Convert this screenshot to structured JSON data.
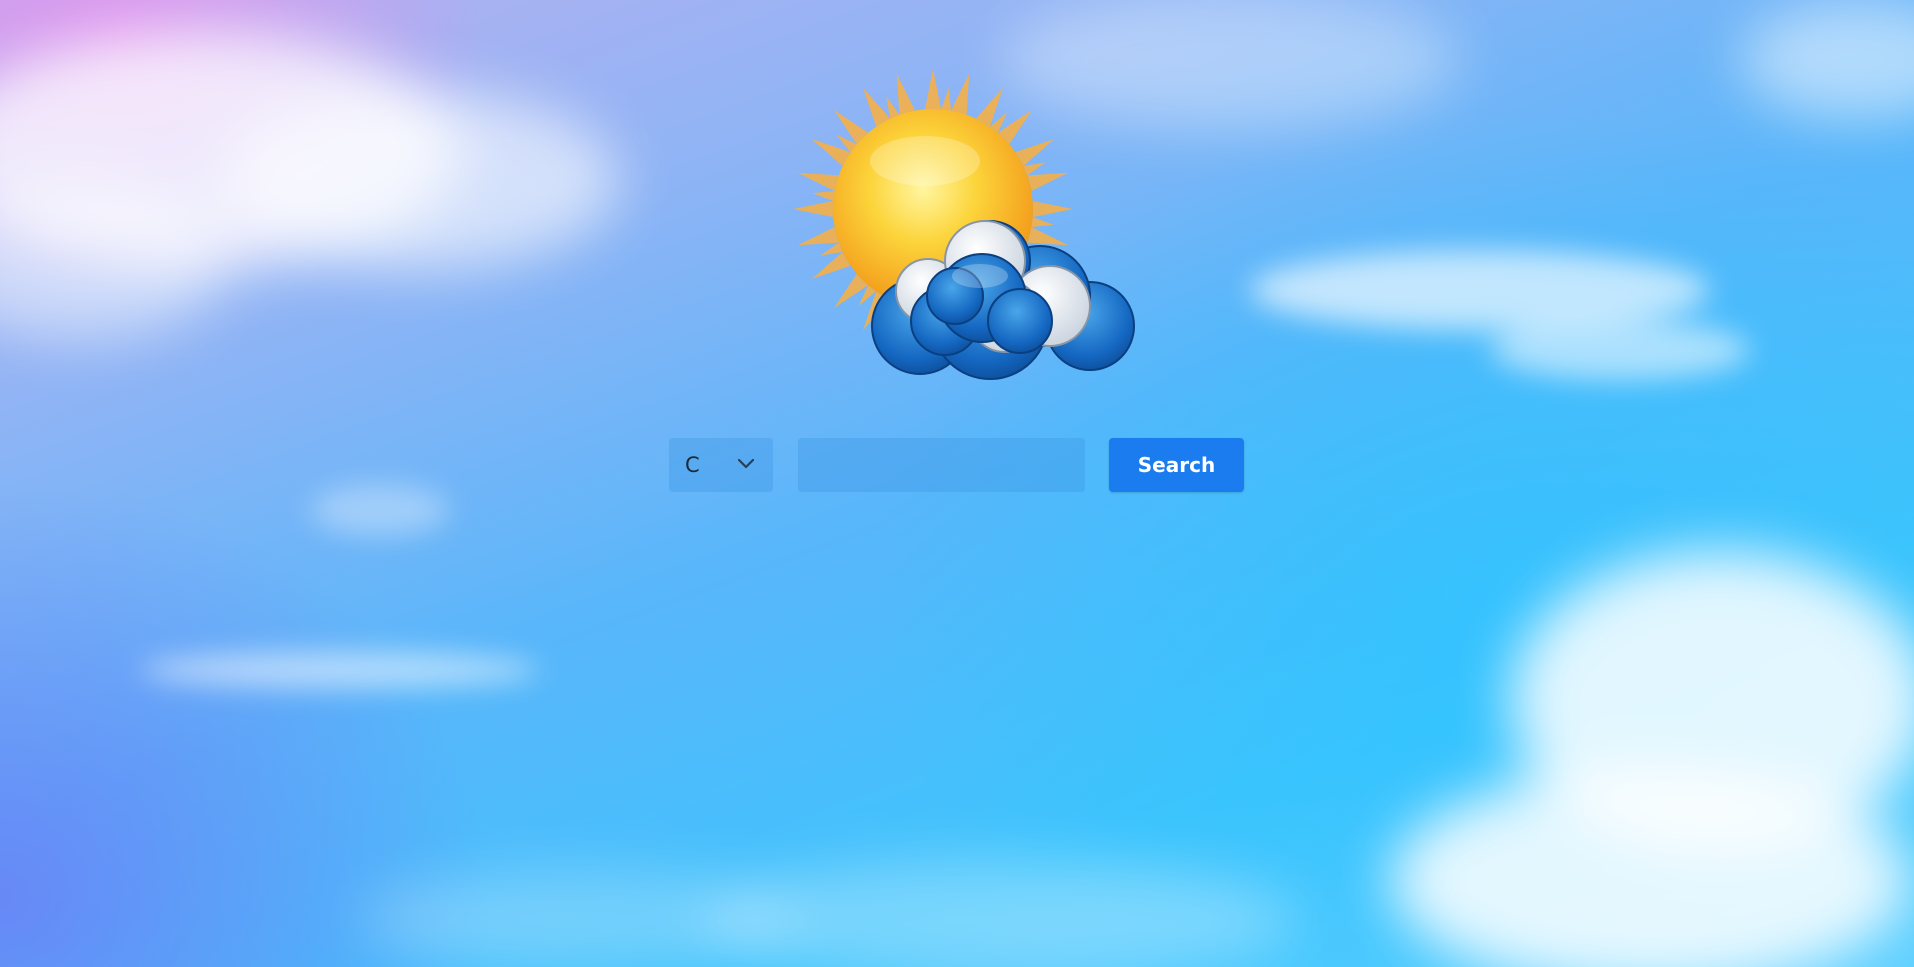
{
  "search": {
    "unit_selected": "C",
    "unit_options": [
      "C"
    ],
    "city_value": "",
    "city_placeholder": "",
    "button_label": "Search"
  },
  "icons": {
    "logo": "sun-behind-cloud-icon",
    "unit_dropdown": "chevron-down-icon"
  },
  "colors": {
    "search_button": "#1b7cf0",
    "sky_top_left": "#e6a0ee",
    "sky_mid": "#58b6fa",
    "sky_bottom_right": "#3fc4fd"
  }
}
